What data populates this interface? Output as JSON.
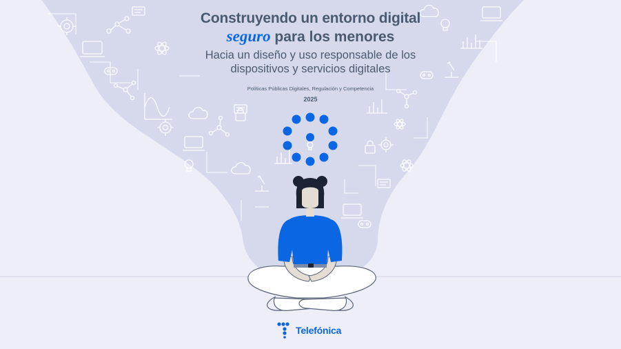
{
  "cover": {
    "title_line1": "Construyendo un entorno digital",
    "title_em": "seguro",
    "title_line2_rest": " para los menores",
    "subtitle_line1": "Hacia un diseño y uso responsable de los",
    "subtitle_line2": "dispositivos y servicios digitales",
    "department": "Políticas Públicas Digitales, Regulación y Competencia",
    "year": "2025"
  },
  "brand": {
    "name": "Telefónica"
  },
  "colors": {
    "background": "#eeeef8",
    "cloud": "#d6d9ec",
    "accent_blue": "#0b66e4",
    "text_gray": "#4a5a70",
    "hair": "#1c2333",
    "skin": "#e4ddd3"
  },
  "icons": [
    "gear-icon",
    "chart-icon",
    "cloud-icon",
    "lock-icon",
    "lightbulb-icon",
    "robot-icon",
    "microscope-icon",
    "document-icon",
    "laptop-icon",
    "network-icon"
  ]
}
